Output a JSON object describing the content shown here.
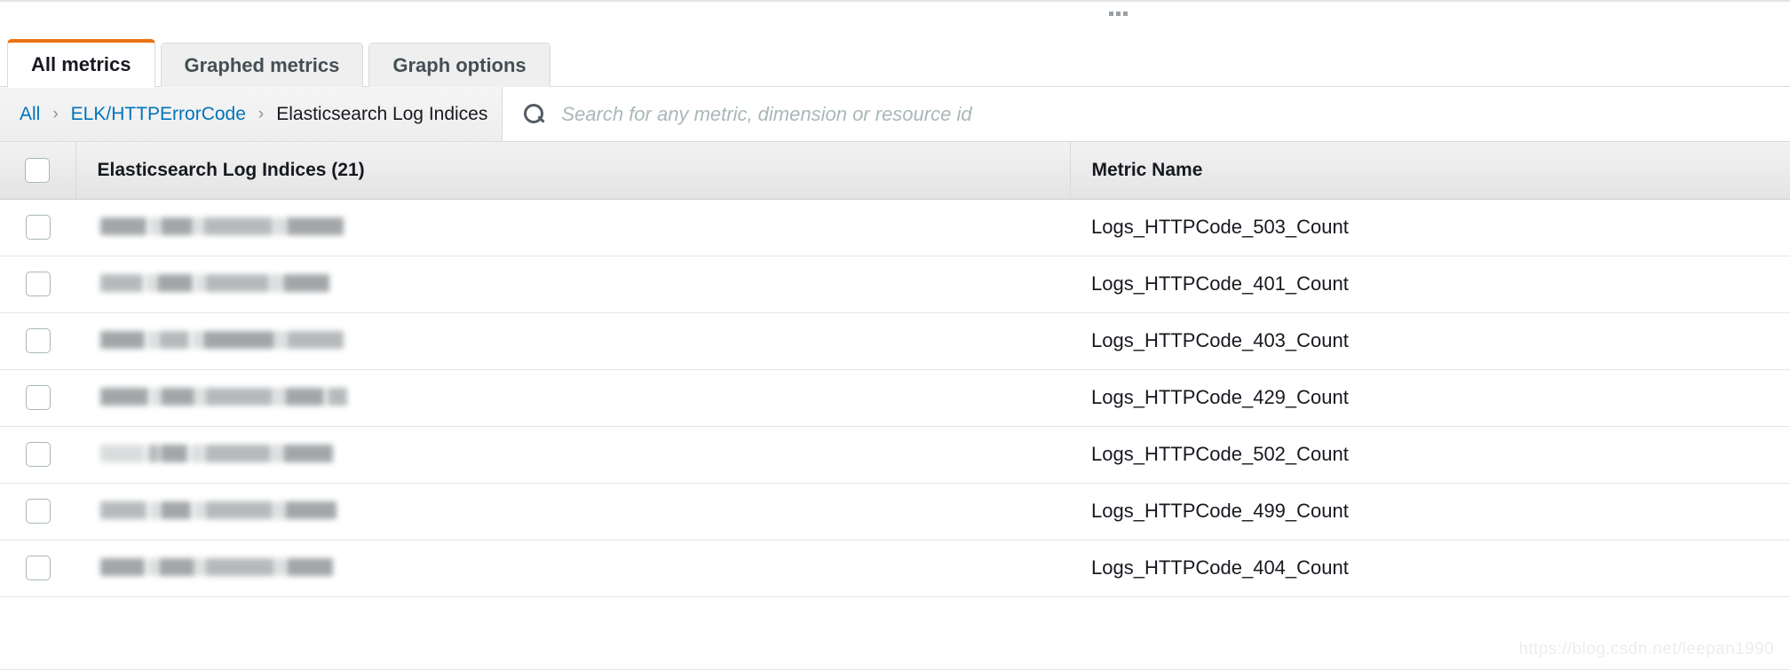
{
  "window": {
    "drag_handle_icon": "drag-dots-icon"
  },
  "tabs": [
    {
      "label": "All metrics",
      "active": true
    },
    {
      "label": "Graphed metrics",
      "active": false
    },
    {
      "label": "Graph options",
      "active": false
    }
  ],
  "toolbar": {
    "breadcrumb": [
      {
        "label": "All",
        "type": "link"
      },
      {
        "label": "ELK/HTTPErrorCode",
        "type": "link"
      },
      {
        "label": "Elasticsearch Log Indices",
        "type": "current"
      }
    ],
    "separator": "›",
    "search": {
      "icon": "search-icon",
      "value": "",
      "placeholder": "Search for any metric, dimension or resource id"
    }
  },
  "table": {
    "select_all_checkbox": "unchecked",
    "columns": [
      {
        "key": "checkbox",
        "label": ""
      },
      {
        "key": "dimension",
        "label": "Elasticsearch Log Indices (21)"
      },
      {
        "key": "metric",
        "label": "Metric Name"
      }
    ],
    "row_count_label": "(21)",
    "rows": [
      {
        "dimension": "",
        "dimension_state": "redacted",
        "metric": "Logs_HTTPCode_503_Count",
        "checked": false
      },
      {
        "dimension": "",
        "dimension_state": "redacted",
        "metric": "Logs_HTTPCode_401_Count",
        "checked": false
      },
      {
        "dimension": "",
        "dimension_state": "redacted",
        "metric": "Logs_HTTPCode_403_Count",
        "checked": false
      },
      {
        "dimension": "",
        "dimension_state": "redacted",
        "metric": "Logs_HTTPCode_429_Count",
        "checked": false
      },
      {
        "dimension": "",
        "dimension_state": "redacted",
        "metric": "Logs_HTTPCode_502_Count",
        "checked": false
      },
      {
        "dimension": "",
        "dimension_state": "redacted",
        "metric": "Logs_HTTPCode_499_Count",
        "checked": false
      },
      {
        "dimension": "",
        "dimension_state": "redacted",
        "metric": "Logs_HTTPCode_404_Count",
        "checked": false
      }
    ]
  },
  "watermark": {
    "text": "https://blog.csdn.net/leepan1990"
  },
  "colors": {
    "accent": "#ec7211",
    "link": "#0073bb",
    "text": "#16191f",
    "border": "#d5dbdb",
    "header_bg": "#e4e4e4",
    "tab_inactive_bg": "#efefef"
  }
}
